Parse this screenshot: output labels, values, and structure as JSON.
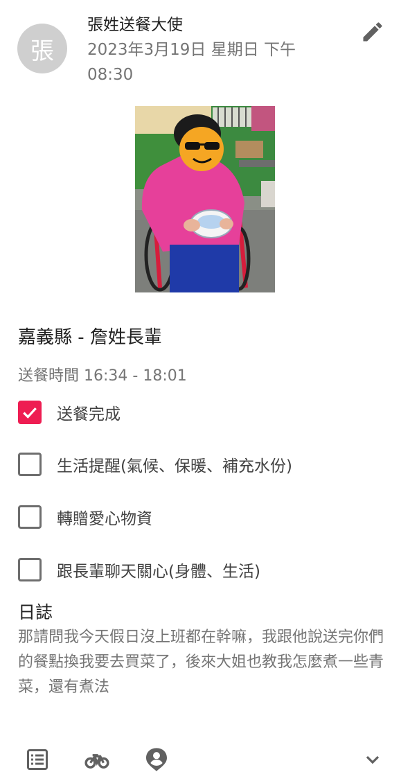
{
  "header": {
    "avatar_text": "張",
    "author": "張姓送餐大使",
    "timestamp": "2023年3月19日 星期日 下午 08:30",
    "edit_icon": "pencil-icon"
  },
  "post": {
    "elder_name": "嘉義縣 - 詹姓長輩",
    "delivery_time": "送餐時間 16:34 - 18:01",
    "checklist": [
      {
        "label": "送餐完成",
        "checked": true
      },
      {
        "label": "生活提醒(氣候、保暖、補充水份)",
        "checked": false
      },
      {
        "label": "轉贈愛心物資",
        "checked": false
      },
      {
        "label": "跟長輩聊天關心(身體、生活)",
        "checked": false
      }
    ],
    "log_title": "日誌",
    "log_text": "那請問我今天假日沒上班都在幹嘛，我跟他說送完你們的餐點換我要去買菜了，後來大姐也教我怎麼煮一些青菜，還有煮法"
  },
  "bottom_bar": {
    "icons": [
      "list-icon",
      "bicycle-icon",
      "person-pin-icon",
      "chevron-down-icon"
    ]
  },
  "colors": {
    "accent": "#ee1d52",
    "icon_gray": "#616161",
    "secondary_text": "#757575"
  }
}
